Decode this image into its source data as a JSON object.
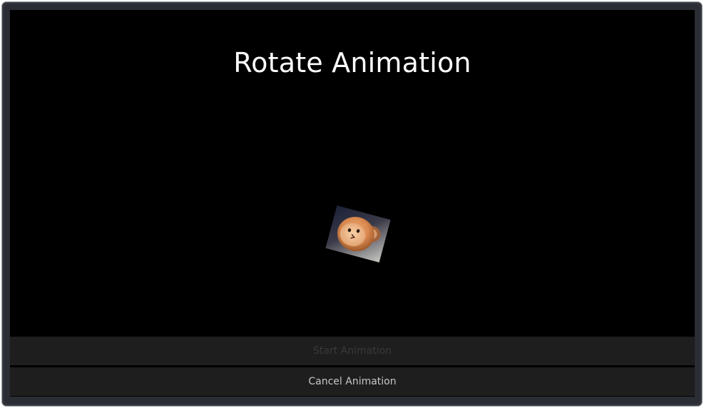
{
  "page": {
    "title": "Rotate Animation"
  },
  "image": {
    "icon": "monkey-face-image"
  },
  "buttons": {
    "start_label": "Start Animation",
    "cancel_label": "Cancel Animation"
  },
  "colors": {
    "background": "#000000",
    "title_text": "#ffffff",
    "button_bg": "#1e1e1e",
    "button_text_enabled": "#c8c8c8",
    "button_text_disabled": "#3a3a3a"
  }
}
